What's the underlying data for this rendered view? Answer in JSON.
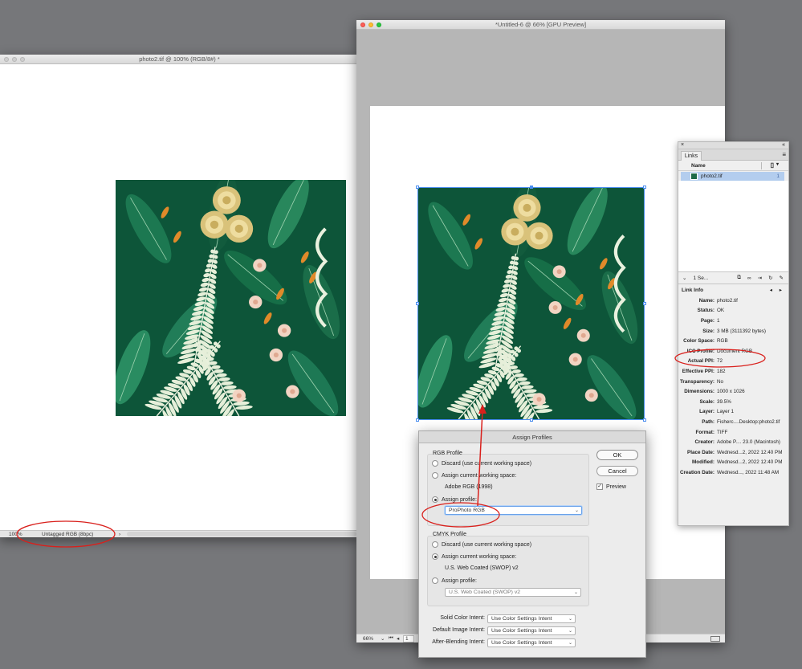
{
  "photo_window": {
    "title": "photo2.tif @ 100% (RGB/8#) *",
    "zoom": "100%",
    "profile_status": "Untagged RGB (8bpc)",
    "status_arrow": "›"
  },
  "indesign_window": {
    "title": "*Untitled-6 @ 66% [GPU Preview]",
    "zoom": "66%",
    "page_field": "1"
  },
  "links_panel": {
    "tab": "Links",
    "column_name": "Name",
    "file": "photo2.tif",
    "selection_summary": "1 Se...",
    "link_info_title": "Link Info",
    "info": [
      {
        "label": "Name:",
        "value": "photo2.tif"
      },
      {
        "label": "Status:",
        "value": "OK"
      },
      {
        "label": "Page:",
        "value": "1"
      },
      {
        "label": "Size:",
        "value": "3 MB (3111392 bytes)"
      },
      {
        "label": "Color Space:",
        "value": "RGB"
      },
      {
        "label": "ICC Profile:",
        "value": "Document RGB"
      },
      {
        "label": "Actual PPI:",
        "value": "72"
      },
      {
        "label": "Effective PPI:",
        "value": "182"
      },
      {
        "label": "Transparency:",
        "value": "No"
      },
      {
        "label": "Dimensions:",
        "value": "1000 x 1026"
      },
      {
        "label": "Scale:",
        "value": "39.5%"
      },
      {
        "label": "Layer:",
        "value": "Layer 1"
      },
      {
        "label": "Path:",
        "value": "Fisherc....Desktop:photo2.tif"
      },
      {
        "label": "Format:",
        "value": "TIFF"
      },
      {
        "label": "Creator:",
        "value": "Adobe P.... 23.0 (Macintosh)"
      },
      {
        "label": "Place Date:",
        "value": "Wednesd...2, 2022 12:40 PM"
      },
      {
        "label": "Modified:",
        "value": "Wednesd...2, 2022 12:40 PM"
      },
      {
        "label": "Creation Date:",
        "value": "Wednesd..., 2022 11:48 AM"
      }
    ]
  },
  "dialog": {
    "title": "Assign Profiles",
    "rgb": {
      "label": "RGB Profile",
      "discard": "Discard (use current working space)",
      "assign_current": "Assign current working space:",
      "current_space": "Adobe RGB (1998)",
      "assign_profile": "Assign profile:",
      "profile_value": "ProPhoto RGB"
    },
    "cmyk": {
      "label": "CMYK Profile",
      "discard": "Discard (use current working space)",
      "assign_current": "Assign current working space:",
      "current_space": "U.S. Web Coated (SWOP) v2",
      "assign_profile": "Assign profile:",
      "profile_value": "U.S. Web Coated (SWOP) v2"
    },
    "intents": [
      {
        "label": "Solid Color Intent:",
        "value": "Use Color Settings Intent"
      },
      {
        "label": "Default Image Intent:",
        "value": "Use Color Settings Intent"
      },
      {
        "label": "After-Blending Intent:",
        "value": "Use Color Settings Intent"
      }
    ],
    "ok": "OK",
    "cancel": "Cancel",
    "preview": "Preview"
  },
  "colors": {
    "annotation": "#d9201c",
    "pattern_bg": "#0d5539",
    "selection": "#4a8df0"
  }
}
